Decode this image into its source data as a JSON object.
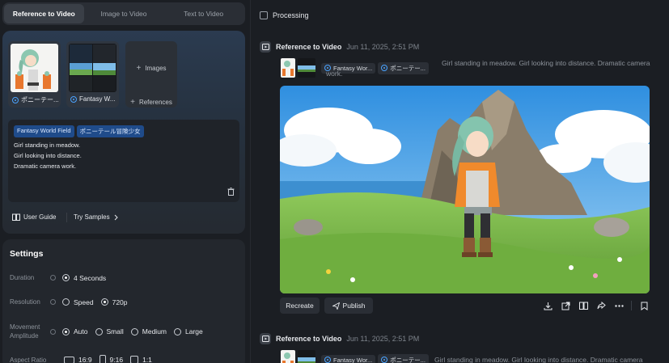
{
  "tabs": [
    {
      "label": "Reference to Video",
      "active": true
    },
    {
      "label": "Image to Video",
      "active": false
    },
    {
      "label": "Text to Video",
      "active": false
    }
  ],
  "references": [
    {
      "label": "ポニーテー..."
    },
    {
      "label": "Fantasy W..."
    }
  ],
  "add_buttons": {
    "images": "Images",
    "references": "References"
  },
  "prompt": {
    "chips": [
      "Fantasy World Field",
      "ポニーテール冒険少女"
    ],
    "lines": [
      "Girl standing in meadow.",
      "Girl looking into distance.",
      "Dramatic camera work."
    ]
  },
  "links": {
    "user_guide": "User Guide",
    "try_samples": "Try Samples"
  },
  "settings": {
    "title": "Settings",
    "duration": {
      "label": "Duration",
      "options": [
        "4 Seconds"
      ]
    },
    "resolution": {
      "label": "Resolution",
      "options": [
        "Speed",
        "720p"
      ]
    },
    "movement": {
      "label": "Movement Amplitude",
      "options": [
        "Auto",
        "Small",
        "Medium",
        "Large"
      ]
    },
    "aspect": {
      "label": "Aspect Ratio",
      "options": [
        "16:9",
        "9:16",
        "1:1"
      ]
    }
  },
  "processing": {
    "label": "Processing"
  },
  "entries": [
    {
      "title": "Reference to Video",
      "date": "Jun 11, 2025, 2:51 PM",
      "chips": [
        "Fantasy Wor...",
        "ポニーテー..."
      ],
      "prompt": "Girl standing in meadow. Girl looking into distance. Dramatic camera work."
    },
    {
      "title": "Reference to Video",
      "date": "Jun 11, 2025, 2:51 PM",
      "chips": [
        "Fantasy Wor...",
        "ポニーテー..."
      ],
      "prompt": "Girl standing in meadow. Girl looking into distance. Dramatic camera"
    }
  ],
  "actions": {
    "recreate": "Recreate",
    "publish": "Publish"
  },
  "icons": [
    "download-icon",
    "export-icon",
    "book-icon",
    "share-icon",
    "more-icon",
    "bookmark-icon"
  ],
  "colors": {
    "accent": "#1f4b8a",
    "chip_text": "#dbe8ff",
    "background": "#1b1e23",
    "panel": "#23272d"
  }
}
